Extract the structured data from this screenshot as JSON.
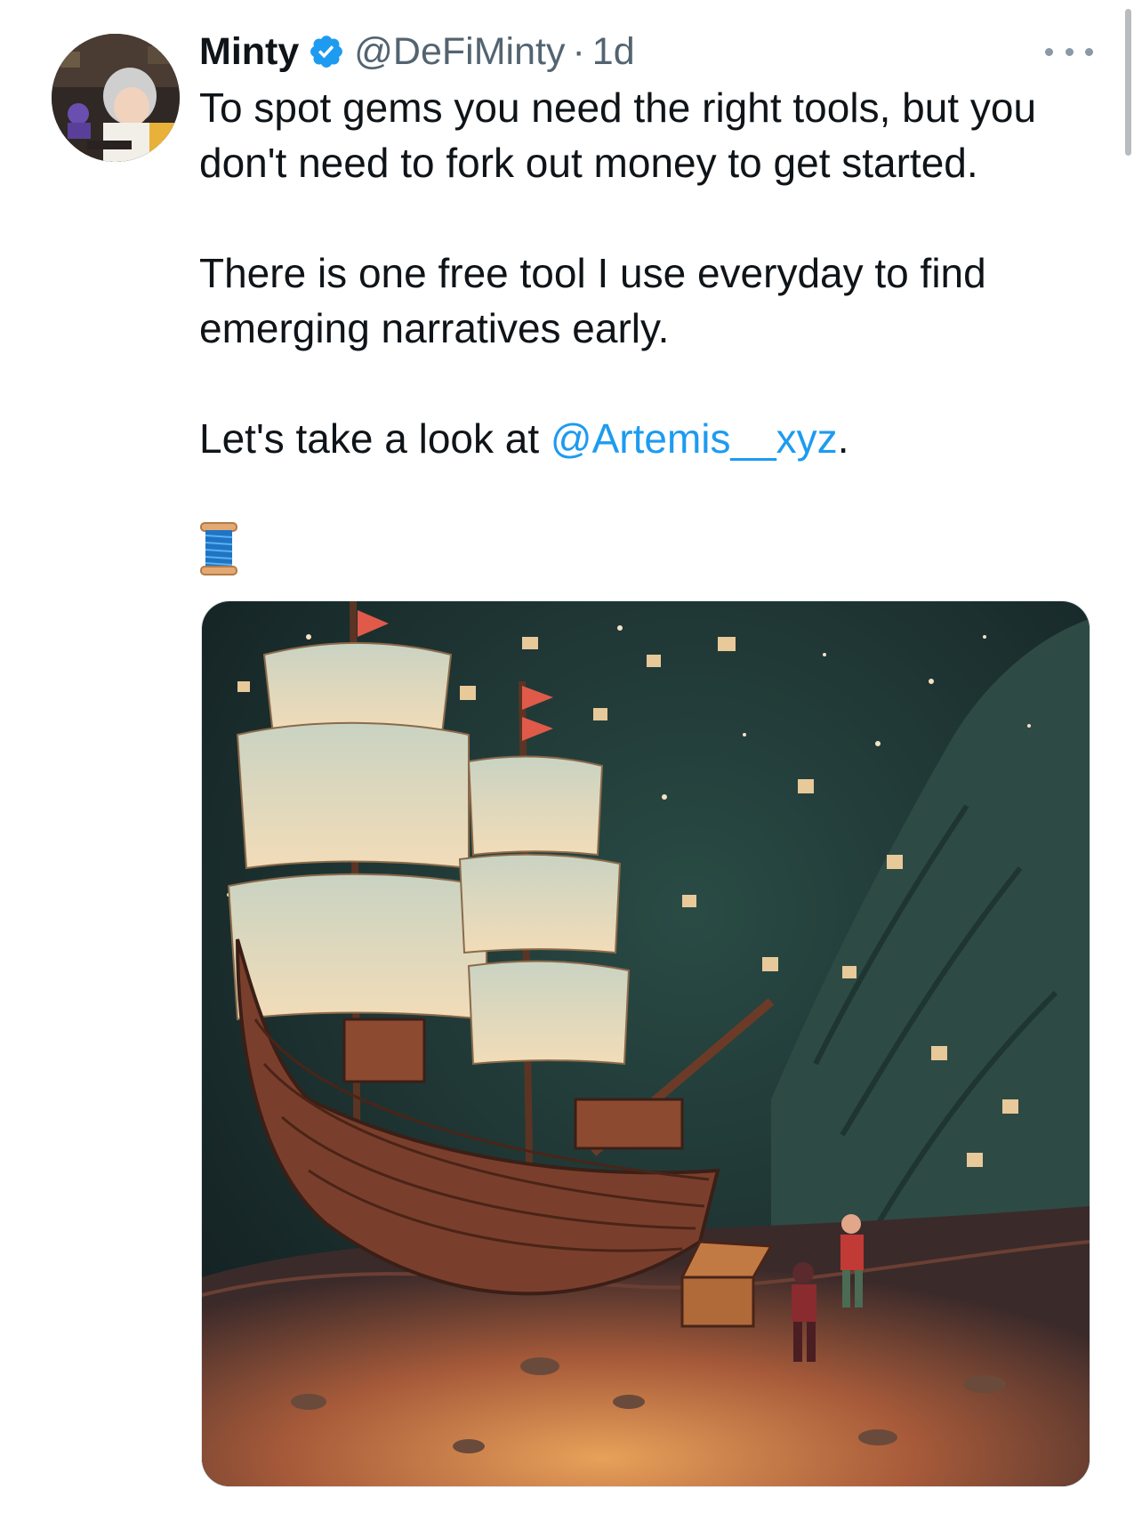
{
  "tweet": {
    "display_name": "Minty",
    "handle": "@DeFiMinty",
    "separator": "·",
    "time": "1d",
    "text_line_1": "To spot gems you need the right tools, but you",
    "text_line_2": "don't need to fork out money to get started.",
    "text_line_3": "There is one free tool I use everyday to find",
    "text_line_4": "emerging narratives early.",
    "text_line_5_prefix": "Let's take a look at ",
    "mention": "@Artemis__xyz",
    "text_line_5_suffix": ".",
    "emoji": "🧵"
  },
  "colors": {
    "accent": "#1d9bf0",
    "text": "#0f1419",
    "muted": "#536471"
  },
  "icons": {
    "verified": "verified-badge-icon",
    "more": "more-options-icon",
    "thread": "spool-of-thread-icon"
  }
}
